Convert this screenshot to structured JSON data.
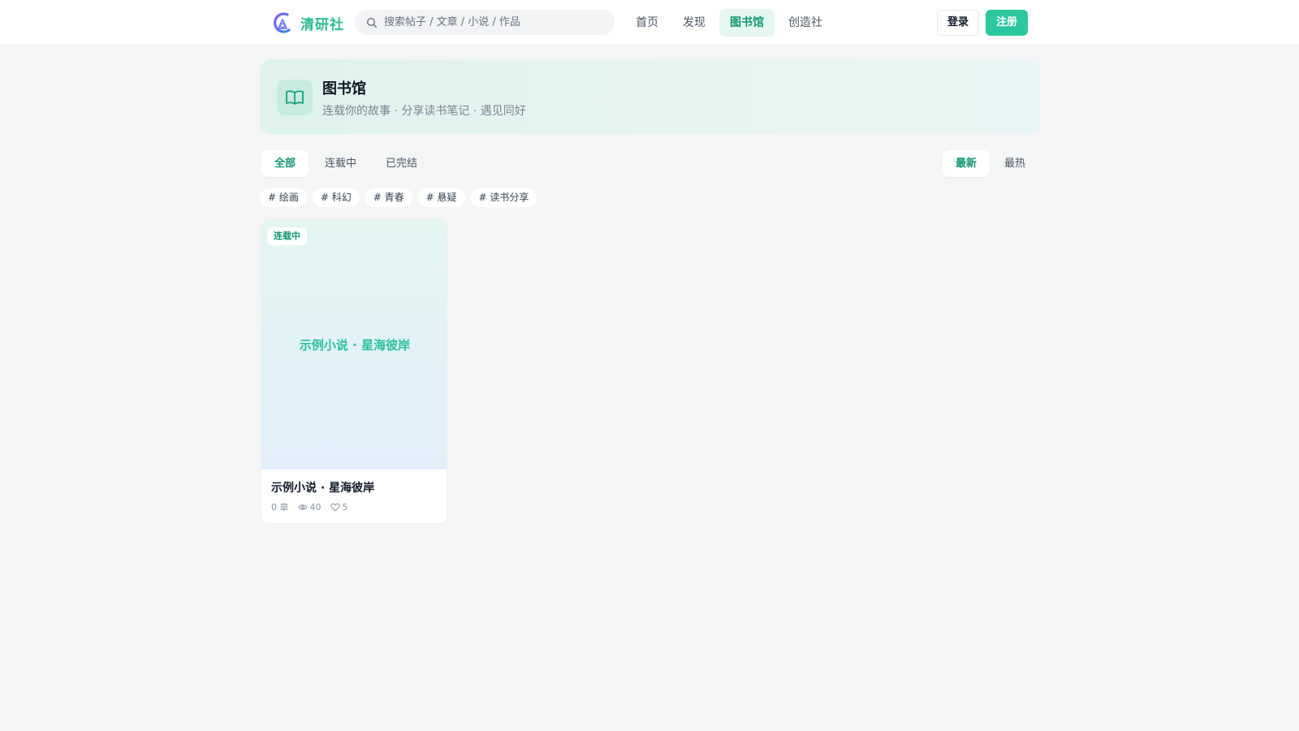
{
  "header": {
    "brand": "清研社",
    "search_placeholder": "搜索帖子 / 文章 / 小说 / 作品",
    "nav": [
      {
        "label": "首页"
      },
      {
        "label": "发现"
      },
      {
        "label": "图书馆",
        "active": true
      },
      {
        "label": "创造社"
      }
    ],
    "login_label": "登录",
    "register_label": "注册"
  },
  "hero": {
    "title": "图书馆",
    "subtitle": "连载你的故事 · 分享读书笔记 · 遇见同好",
    "icon": "open-book-icon"
  },
  "filters": {
    "status_tabs": [
      {
        "label": "全部",
        "active": true
      },
      {
        "label": "连载中"
      },
      {
        "label": "已完结"
      }
    ],
    "sort_tabs": [
      {
        "label": "最新",
        "active": true
      },
      {
        "label": "最热"
      }
    ],
    "tags": [
      "# 绘画",
      "# 科幻",
      "# 青春",
      "# 悬疑",
      "# 读书分享"
    ]
  },
  "books": [
    {
      "status_badge": "连载中",
      "cover_title": "示例小说 · 星海彼岸",
      "title": "示例小说 · 星海彼岸",
      "chapters": "0 章",
      "views": "40",
      "likes": "5"
    }
  ],
  "colors": {
    "accent": "#2cc7a0",
    "accent_dark": "#129671",
    "page_bg": "#f4f6f6"
  }
}
